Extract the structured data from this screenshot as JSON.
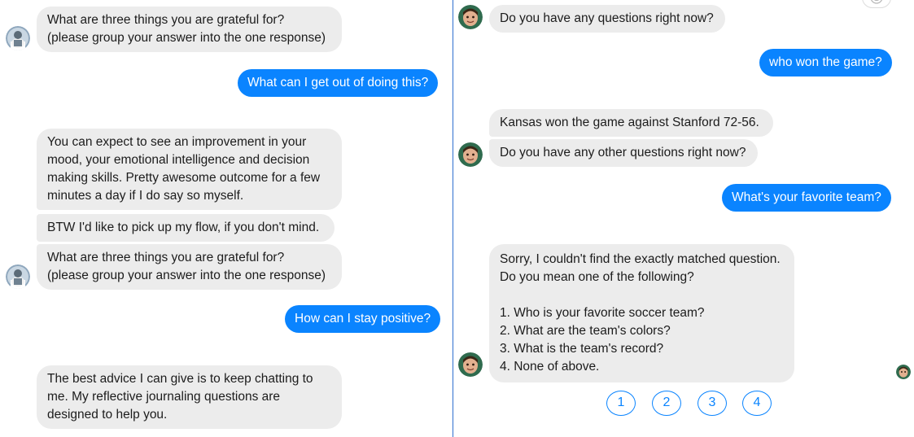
{
  "left_panel": {
    "messages": [
      {
        "id": "m1",
        "role": "bot",
        "text": "What are three things you are grateful for?\n(please group your answer into the one response)"
      },
      {
        "id": "m2",
        "role": "user",
        "text": "What can I get out of doing this?"
      },
      {
        "id": "m3",
        "role": "bot",
        "text": "You can expect to see an improvement in your mood, your emotional intelligence and decision making skills.  Pretty awesome outcome for a few minutes a day if I do say so myself."
      },
      {
        "id": "m4",
        "role": "bot",
        "text": "BTW I'd like to pick up my flow, if you don't mind."
      },
      {
        "id": "m5",
        "role": "bot",
        "text": "What are three things you are grateful for?\n(please group your answer into the one response)"
      },
      {
        "id": "m6",
        "role": "user",
        "text": "How can I stay positive?"
      },
      {
        "id": "m7",
        "role": "bot",
        "text": "The best advice I can give is to keep chatting to me.  My reflective journaling questions are designed to help you."
      }
    ]
  },
  "right_panel": {
    "messages": [
      {
        "id": "r1",
        "role": "bot",
        "text": "Do you have any questions right now?"
      },
      {
        "id": "r2",
        "role": "user",
        "text": "who won the game?"
      },
      {
        "id": "r3",
        "role": "bot",
        "text": "Kansas won the game against Stanford 72-56."
      },
      {
        "id": "r4",
        "role": "bot",
        "text": "Do you have any other questions right now?"
      },
      {
        "id": "r5",
        "role": "user",
        "text": "What's your favorite team?"
      },
      {
        "id": "r6",
        "role": "bot",
        "text": "Sorry, I couldn't find the exactly matched question. Do you mean one of the following?\n\n1. Who is your favorite soccer team?\n2. What are the team's colors?\n3. What is the team's record?\n4. None of above."
      }
    ],
    "quick_replies": [
      "1",
      "2",
      "3",
      "4"
    ]
  },
  "icons": {
    "left_avatar": "user-avatar-icon",
    "right_avatar": "bot-avatar-icon",
    "corner": "smiley-icon",
    "typing": "bot-avatar-small-icon"
  },
  "colors": {
    "accent": "#0a84ff",
    "bubble_incoming": "#ececec",
    "divider": "#2f6fd0"
  }
}
